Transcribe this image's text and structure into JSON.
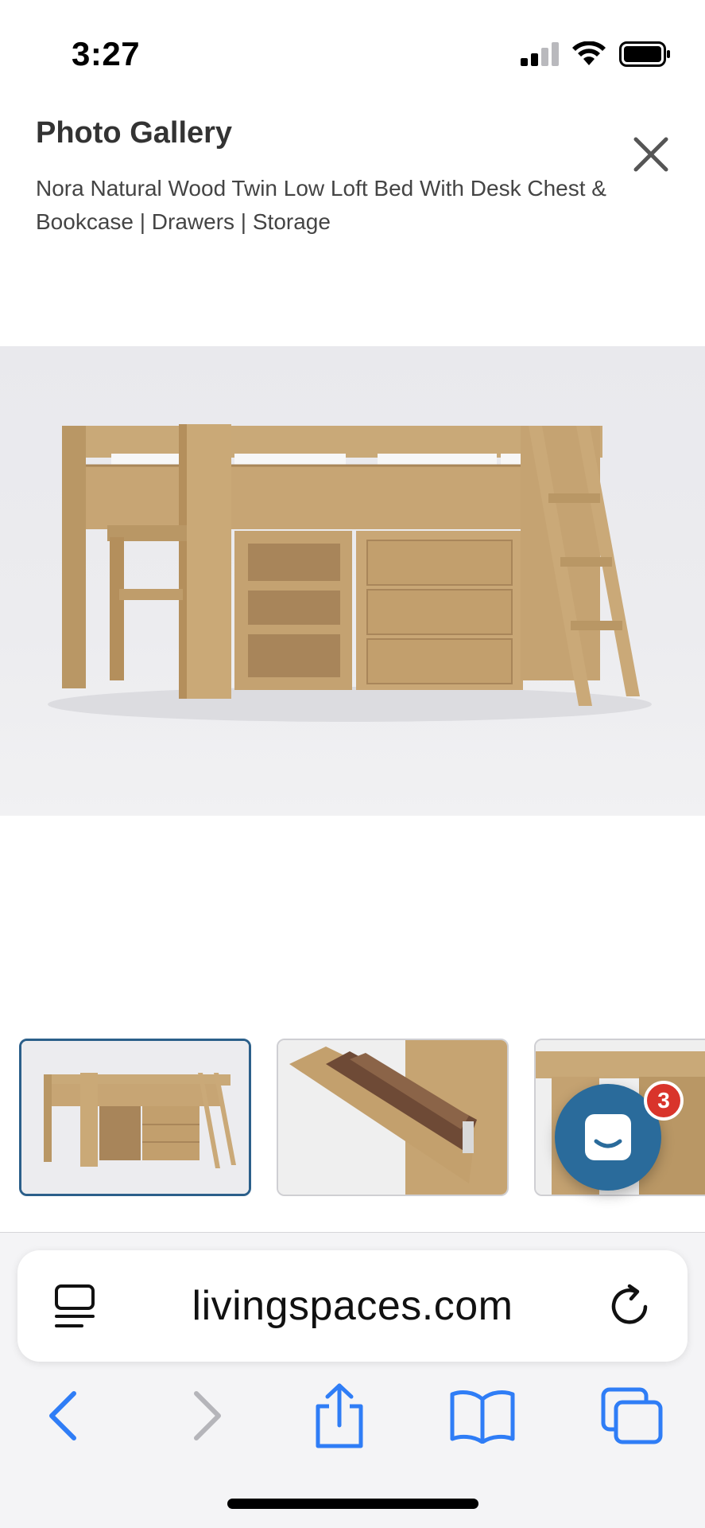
{
  "status_bar": {
    "time": "3:27",
    "icons": [
      "cellular-signal-icon",
      "wifi-icon",
      "battery-icon"
    ]
  },
  "gallery": {
    "title": "Photo Gallery",
    "product_name": "Nora Natural Wood Twin Low Loft Bed With Desk Chest & Bookcase | Drawers | Storage",
    "close_icon": "close-icon"
  },
  "main_image": {
    "subject": "natural-wood-low-loft-bed-with-bookcase-and-chest"
  },
  "thumbnails": [
    {
      "subject": "loft-bed-front-view",
      "selected": true
    },
    {
      "subject": "drawer-open-detail",
      "selected": false
    },
    {
      "subject": "desk-detail",
      "selected": false
    }
  ],
  "chat": {
    "badge_count": "3",
    "icon": "chat-bubble-icon"
  },
  "browser": {
    "url": "livingspaces.com",
    "reader_icon": "reader-mode-icon",
    "reload_icon": "reload-icon",
    "toolbar": [
      "back-icon",
      "forward-icon",
      "share-icon",
      "bookmarks-icon",
      "tabs-icon"
    ]
  },
  "colors": {
    "accent": "#2f7df6",
    "selected_thumb_border": "#2b5f8a",
    "chat_bg": "#2a6b9b",
    "badge": "#d9342b",
    "wood": "#c9a978"
  }
}
